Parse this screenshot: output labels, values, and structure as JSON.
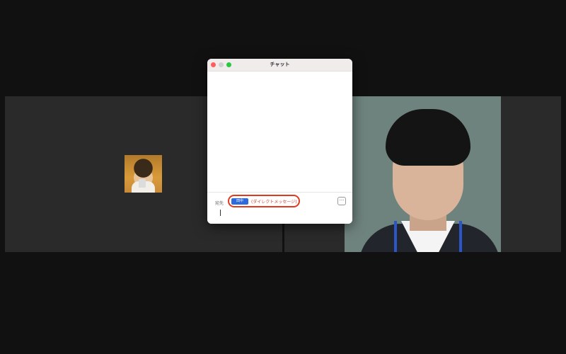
{
  "chat": {
    "title": "チャット",
    "to_label": "宛先",
    "recipient": {
      "chip_text": "田中",
      "note": "(ダイレクトメッセージ)"
    },
    "more_label": "···",
    "input_value": "",
    "input_placeholder": ""
  },
  "colors": {
    "background": "#111111",
    "tile": "#2a2a2a",
    "highlight": "#e23a1e",
    "recipient_chip": "#2d6bdc",
    "close": "#ff5f57",
    "minimize": "#cfcfcf",
    "maximize": "#28c840"
  }
}
